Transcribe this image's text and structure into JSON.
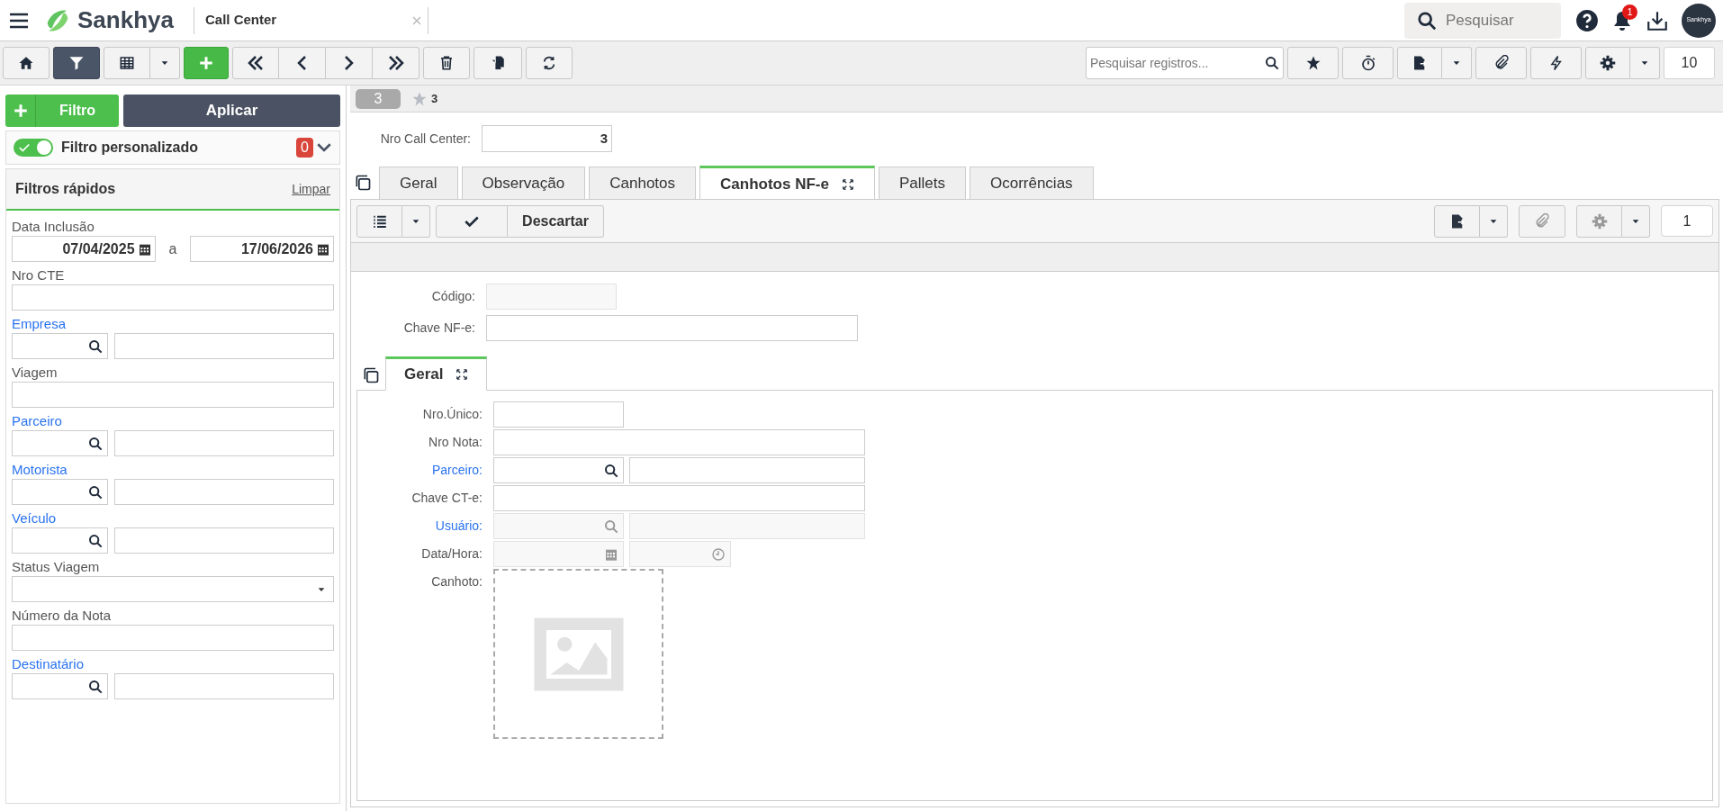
{
  "header": {
    "brand": "Sankhya",
    "title": "Call Center",
    "search_placeholder": "Pesquisar",
    "notification_count": "1",
    "avatar_text": "Sankhya"
  },
  "toolbar": {
    "filter_active": true,
    "search_placeholder": "Pesquisar registros...",
    "record_count": "10"
  },
  "filter_panel": {
    "add_label": "Filtro",
    "apply_label": "Aplicar",
    "custom_filter": {
      "label": "Filtro personalizado",
      "on": true,
      "count": "0"
    },
    "quick_title": "Filtros rápidos",
    "clear_label": "Limpar",
    "filters": [
      {
        "kind": "date_range",
        "label": "Data Inclusão",
        "from": "07/04/2025",
        "separator": "a",
        "to": "17/06/2026"
      },
      {
        "kind": "text",
        "label": "Nro CTE"
      },
      {
        "kind": "lookup",
        "label": "Empresa"
      },
      {
        "kind": "text",
        "label": "Viagem"
      },
      {
        "kind": "lookup",
        "label": "Parceiro"
      },
      {
        "kind": "lookup",
        "label": "Motorista"
      },
      {
        "kind": "lookup",
        "label": "Veículo"
      },
      {
        "kind": "select",
        "label": "Status Viagem"
      },
      {
        "kind": "text",
        "label": "Número da Nota"
      },
      {
        "kind": "lookup",
        "label": "Destinatário"
      }
    ]
  },
  "record": {
    "badge": "3",
    "favorite_count": "3",
    "nro_label": "Nro Call Center:",
    "nro_value": "3"
  },
  "tabs": [
    {
      "label": "Geral",
      "selected": false
    },
    {
      "label": "Observação",
      "selected": false
    },
    {
      "label": "Canhotos",
      "selected": false
    },
    {
      "label": "Canhotos NF-e",
      "selected": true
    },
    {
      "label": "Pallets",
      "selected": false
    },
    {
      "label": "Ocorrências",
      "selected": false
    }
  ],
  "detail": {
    "discard_label": "Descartar",
    "record_count": "1",
    "fields": [
      {
        "label": "Código:",
        "disabled": true
      },
      {
        "label": "Chave NF-e:",
        "disabled": false
      }
    ],
    "inner_tabs": [
      {
        "label": "Geral",
        "selected": true
      }
    ],
    "form": [
      {
        "kind": "short",
        "label": "Nro.Único:",
        "disabled": false
      },
      {
        "kind": "text",
        "label": "Nro Nota:",
        "disabled": false
      },
      {
        "kind": "lookup",
        "label": "Parceiro:",
        "disabled": false
      },
      {
        "kind": "text",
        "label": "Chave CT-e:",
        "disabled": false
      },
      {
        "kind": "lookup",
        "label": "Usuário:",
        "disabled": true
      },
      {
        "kind": "datetime",
        "label": "Data/Hora:",
        "disabled": true
      },
      {
        "kind": "image",
        "label": "Canhoto:"
      }
    ]
  }
}
